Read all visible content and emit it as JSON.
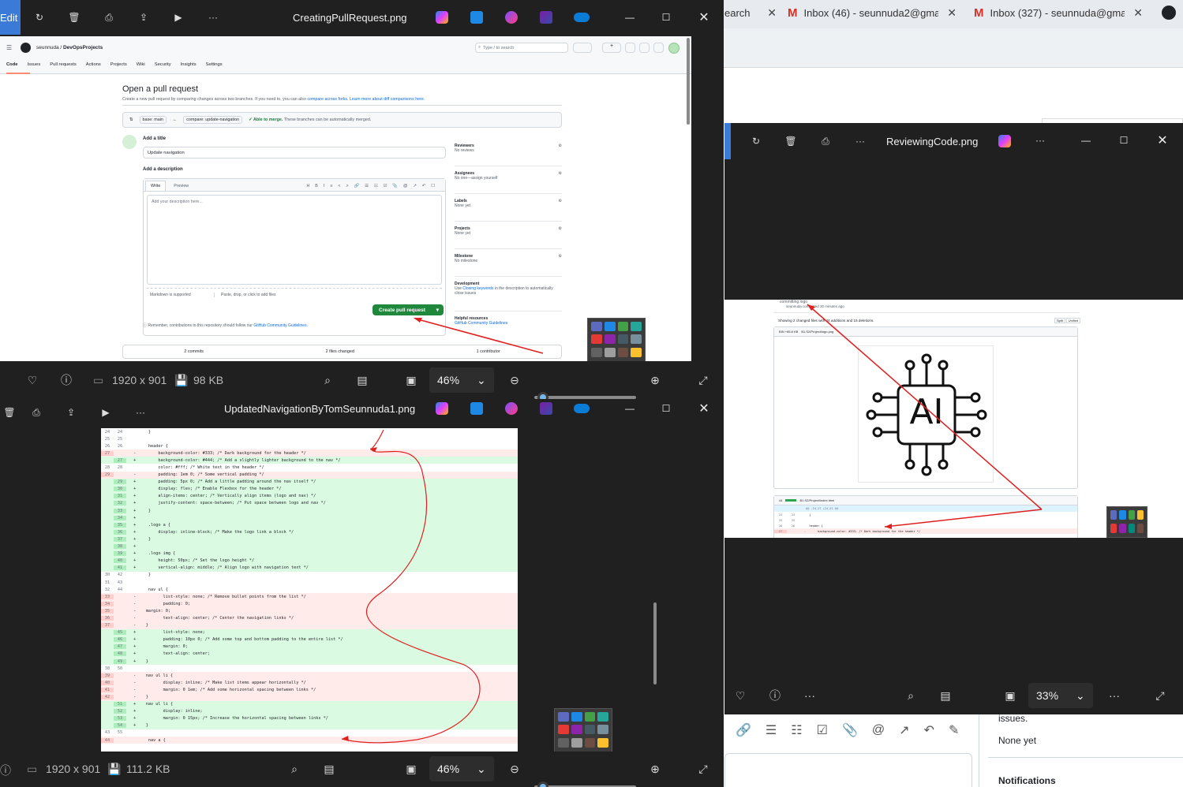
{
  "browser": {
    "tabs": [
      {
        "label": "earch"
      },
      {
        "label": "Inbox (46) - seunnuda2@gmail.",
        "icon": "gmail-icon"
      },
      {
        "label": "Inbox (327) - seunnuda@gmail",
        "icon": "gmail-icon"
      }
    ],
    "close": "✕",
    "page_issues_text": "issues.",
    "page_none_yet": "None yet",
    "page_notifications": "Notifications"
  },
  "viewer1": {
    "edit_label": "Edit",
    "title": "CreatingPullRequest.png",
    "dimensions": "1920 x 901",
    "filesize": "98 KB",
    "zoom": "46%"
  },
  "viewer2": {
    "title": "ReviewingCode.png",
    "zoom": "33%"
  },
  "viewer3": {
    "title": "UpdatedNavigationByTomSeunnuda1.png",
    "dimensions": "1920 x 901",
    "filesize": "111.2 KB",
    "zoom": "46%"
  },
  "github": {
    "owner": "seunnuda",
    "repo": "DevOpsProjects",
    "search_placeholder": "Type / to search",
    "nav": [
      "Code",
      "Issues",
      "Pull requests",
      "Actions",
      "Projects",
      "Wiki",
      "Security",
      "Insights",
      "Settings"
    ],
    "heading": "Open a pull request",
    "subheading_pre": "Create a new pull request by comparing changes across two branches. If you need to, you can also ",
    "compare_forks": "compare across forks.",
    "learn_more": "Learn more about diff comparisons here.",
    "base": "base: main",
    "compare": "compare: update-navigation",
    "merge_ok": "✓ Able to merge.",
    "merge_note": " These branches can be automatically merged.",
    "add_title": "Add a title",
    "title_value": "Update navigation",
    "add_description": "Add a description",
    "write_tab": "Write",
    "preview_tab": "Preview",
    "desc_placeholder": "Add your description here...",
    "markdown_supported": "Markdown is supported",
    "paste_drop": "Paste, drop, or click to add files",
    "create_pr": "Create pull request",
    "remember_pre": "Remember, contributions to this repository should follow our ",
    "community_guidelines": "GitHub Community Guidelines",
    "reviewers": "Reviewers",
    "no_reviews": "No reviews",
    "assignees": "Assignees",
    "no_one": "No one—assign yourself",
    "labels": "Labels",
    "labels_none": "None yet",
    "projects": "Projects",
    "projects_none": "None yet",
    "milestone": "Milestone",
    "no_milestone": "No milestone",
    "development": "Development",
    "dev_text_pre": "Use ",
    "closing_keywords": "Closing keywords",
    "dev_text_post": " in the description to automatically close issues",
    "helpful": "Helpful resources",
    "helpful_link": "GitHub Community Guidelines",
    "commits": "2 commits",
    "files_changed": "2 files changed",
    "contributors": "1 contributor"
  },
  "review": {
    "commit_line": "committing logo",
    "author_line": "seunnuda committed 30 minutes ago",
    "showing": "Showing 2 changed files with 44 additions and 15 deletions.",
    "split": "Split",
    "unified": "Unified",
    "file1": "B1.S2/Project/logo.png",
    "file1_stats": "BIN +85.6 KB",
    "ai_text": "AI",
    "file2": "B1.S2/Project/index.html",
    "file2_stats": "44",
    "hunk": "@@ -24,27 +24,41 @@",
    "lines": [
      {
        "t": "n",
        "a": "24",
        "b": "24",
        "c": "   }"
      },
      {
        "t": "n",
        "a": "25",
        "b": "25",
        "c": ""
      },
      {
        "t": "n",
        "a": "26",
        "b": "26",
        "c": "   header {"
      },
      {
        "t": "d",
        "a": "27",
        "b": "",
        "c": "-       background-color: #333; /* Dark background for the header */"
      }
    ]
  },
  "diff": {
    "lines": [
      {
        "t": "n",
        "a": "24",
        "b": "24",
        "c": "       }"
      },
      {
        "t": "n",
        "a": "25",
        "b": "25",
        "c": ""
      },
      {
        "t": "n",
        "a": "26",
        "b": "26",
        "c": "       header {"
      },
      {
        "t": "d",
        "a": "27",
        "b": "",
        "c": " -         background-color: #333; /* Dark background for the header */"
      },
      {
        "t": "a",
        "a": "",
        "b": "27",
        "c": " +         background-color: #444; /* Add a slightly lighter background to the nav */"
      },
      {
        "t": "n",
        "a": "28",
        "b": "28",
        "c": "           color: #fff; /* White text in the header */"
      },
      {
        "t": "d",
        "a": "29",
        "b": "",
        "c": " -         padding: 1em 0; /* Some vertical padding */"
      },
      {
        "t": "a",
        "a": "",
        "b": "29",
        "c": " +         padding: 5px 0; /* Add a little padding around the nav itself */"
      },
      {
        "t": "a",
        "a": "",
        "b": "30",
        "c": " +         display: flex; /* Enable Flexbox for the header */"
      },
      {
        "t": "a",
        "a": "",
        "b": "31",
        "c": " +         align-items: center; /* Vertically align items (logo and nav) */"
      },
      {
        "t": "a",
        "a": "",
        "b": "32",
        "c": " +         justify-content: space-between; /* Put space between logo and nav */"
      },
      {
        "t": "a",
        "a": "",
        "b": "33",
        "c": " +     }"
      },
      {
        "t": "a",
        "a": "",
        "b": "34",
        "c": " +"
      },
      {
        "t": "a",
        "a": "",
        "b": "35",
        "c": " +     .logo a {"
      },
      {
        "t": "a",
        "a": "",
        "b": "36",
        "c": " +         display: inline-block; /* Make the logo link a block */"
      },
      {
        "t": "a",
        "a": "",
        "b": "37",
        "c": " +     }"
      },
      {
        "t": "a",
        "a": "",
        "b": "38",
        "c": " +"
      },
      {
        "t": "a",
        "a": "",
        "b": "39",
        "c": " +     .logo img {"
      },
      {
        "t": "a",
        "a": "",
        "b": "40",
        "c": " +         height: 50px; /* Set the logo height */"
      },
      {
        "t": "a",
        "a": "",
        "b": "41",
        "c": " +         vertical-align: middle; /* Align logo with navigation text */"
      },
      {
        "t": "n",
        "a": "30",
        "b": "42",
        "c": "       }"
      },
      {
        "t": "n",
        "a": "31",
        "b": "43",
        "c": ""
      },
      {
        "t": "n",
        "a": "32",
        "b": "44",
        "c": "       nav ul {"
      },
      {
        "t": "d",
        "a": "33",
        "b": "",
        "c": " -           list-style: none; /* Remove bullet points from the list */"
      },
      {
        "t": "d",
        "a": "34",
        "b": "",
        "c": " -           padding: 0;"
      },
      {
        "t": "d",
        "a": "35",
        "b": "",
        "c": " -    margin: 0;"
      },
      {
        "t": "d",
        "a": "36",
        "b": "",
        "c": " -           text-align: center; /* Center the navigation links */"
      },
      {
        "t": "d",
        "a": "37",
        "b": "",
        "c": " -    }"
      },
      {
        "t": "a",
        "a": "",
        "b": "45",
        "c": " +           list-style: none;"
      },
      {
        "t": "a",
        "a": "",
        "b": "46",
        "c": " +           padding: 10px 0; /* Add some top and bottom padding to the entire list */"
      },
      {
        "t": "a",
        "a": "",
        "b": "47",
        "c": " +           margin: 0;"
      },
      {
        "t": "a",
        "a": "",
        "b": "48",
        "c": " +           text-align: center;"
      },
      {
        "t": "a",
        "a": "",
        "b": "49",
        "c": " +    }"
      },
      {
        "t": "n",
        "a": "38",
        "b": "50",
        "c": ""
      },
      {
        "t": "d",
        "a": "39",
        "b": "",
        "c": " -    nav ul li {"
      },
      {
        "t": "d",
        "a": "40",
        "b": "",
        "c": " -           display: inline; /* Make list items appear horizontally */"
      },
      {
        "t": "d",
        "a": "41",
        "b": "",
        "c": " -           margin: 0 1em; /* Add some horizontal spacing between links */"
      },
      {
        "t": "d",
        "a": "42",
        "b": "",
        "c": " -    }"
      },
      {
        "t": "a",
        "a": "",
        "b": "51",
        "c": " +    nav ul li {"
      },
      {
        "t": "a",
        "a": "",
        "b": "52",
        "c": " +           display: inline;"
      },
      {
        "t": "a",
        "a": "",
        "b": "53",
        "c": " +           margin: 0 15px; /* Increase the horizontal spacing between links */"
      },
      {
        "t": "a",
        "a": "",
        "b": "54",
        "c": " +    }"
      },
      {
        "t": "n",
        "a": "43",
        "b": "55",
        "c": ""
      },
      {
        "t": "d",
        "a": "44",
        "b": "",
        "c": "       nav a {"
      }
    ]
  }
}
